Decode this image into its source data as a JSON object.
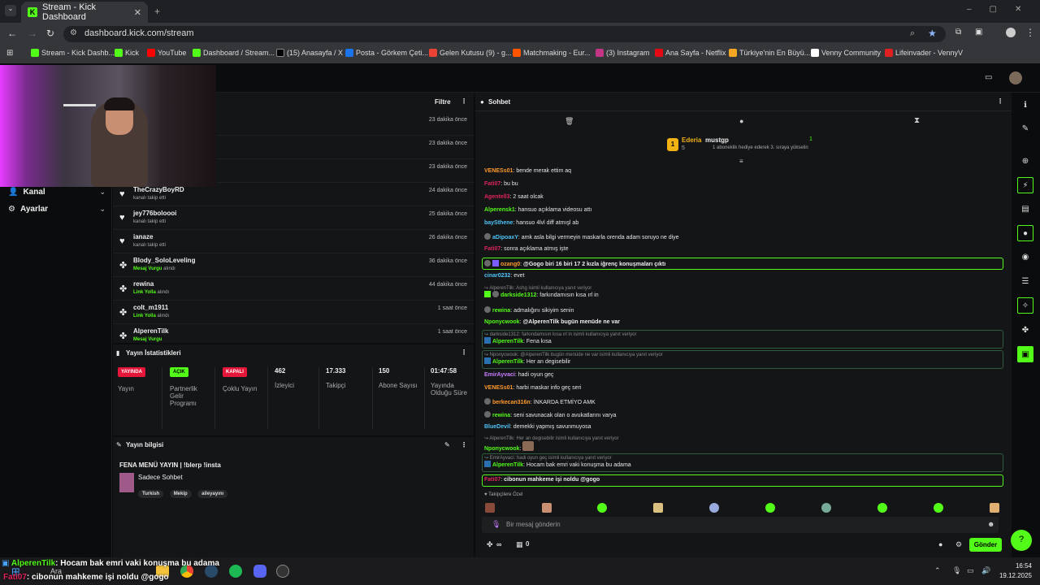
{
  "browser": {
    "tab_title": "Stream - Kick Dashboard",
    "url": "dashboard.kick.com/stream",
    "bookmarks": [
      {
        "label": "Stream - Kick Dashb...",
        "icon": "kick-icon",
        "color": "#53fc18"
      },
      {
        "label": "Kick",
        "icon": "kick-icon",
        "color": "#53fc18"
      },
      {
        "label": "YouTube",
        "icon": "youtube-icon",
        "color": "#ff0000"
      },
      {
        "label": "Dashboard / Stream...",
        "icon": "kick-icon",
        "color": "#53fc18"
      },
      {
        "label": "(15) Anasayfa / X",
        "icon": "x-icon",
        "color": "#000000"
      },
      {
        "label": "Posta - Görkem Çeti...",
        "icon": "mail-icon",
        "color": "#1a73e8"
      },
      {
        "label": "Gelen Kutusu (9) - g...",
        "icon": "gmail-icon",
        "color": "#ea4335"
      },
      {
        "label": "Matchmaking - Eur...",
        "icon": "faceit-icon",
        "color": "#ff5500"
      },
      {
        "label": "(3) Instagram",
        "icon": "instagram-icon",
        "color": "#c13584"
      },
      {
        "label": "Ana Sayfa - Netflix",
        "icon": "netflix-icon",
        "color": "#e50914"
      },
      {
        "label": "Türkiye'nin En Büyü...",
        "icon": "site-icon",
        "color": "#f5a623"
      },
      {
        "label": "Venny Community",
        "icon": "v-icon",
        "color": "#ffffff"
      },
      {
        "label": "Lifeinvader - VennyV",
        "icon": "lifeinvader-icon",
        "color": "#e02020"
      }
    ]
  },
  "leftnav": {
    "items": [
      {
        "label": "Kanal"
      },
      {
        "label": "Ayarlar"
      }
    ]
  },
  "activity": {
    "filter_label": "Filtre",
    "rows": [
      {
        "name": "",
        "sub": "",
        "sub_highlight": "",
        "time": "23 dakika önce"
      },
      {
        "name": "",
        "sub": "",
        "sub_highlight": "",
        "time": "23 dakika önce"
      },
      {
        "name": "",
        "sub": "",
        "sub_highlight": "",
        "time": "23 dakika önce"
      },
      {
        "name": "TheCrazyBoyRD",
        "sub": "kanalı takip etti",
        "sub_highlight": "",
        "time": "24 dakika önce",
        "icon": "heart-icon"
      },
      {
        "name": "jey776boloooi",
        "sub": "kanalı takip etti",
        "sub_highlight": "",
        "time": "25 dakika önce",
        "icon": "heart-icon"
      },
      {
        "name": "ianaze",
        "sub": "kanalı takip etti",
        "sub_highlight": "",
        "time": "26 dakika önce",
        "icon": "heart-icon"
      },
      {
        "name": "Blody_SoloLeveling",
        "sub": "alındı",
        "sub_highlight": "Mesaj Vurgu",
        "time": "36 dakika önce",
        "icon": "reward-icon"
      },
      {
        "name": "rewina",
        "sub": "alındı",
        "sub_highlight": "Link Yolla",
        "time": "44 dakika önce",
        "icon": "reward-icon"
      },
      {
        "name": "colt_m1911",
        "sub": "alındı",
        "sub_highlight": "Link Yolla",
        "time": "1 saat önce",
        "icon": "reward-icon"
      },
      {
        "name": "AlperenTilk",
        "sub": "",
        "sub_highlight": "Mesaj Vurgu",
        "time": "1 saat önce",
        "icon": "reward-icon"
      }
    ]
  },
  "stats": {
    "title": "Yayın İstatistikleri",
    "items": [
      {
        "badge": "YAYINDA",
        "badge_color": "#e4163a",
        "label": "Yayın"
      },
      {
        "badge": "AÇIK",
        "badge_color": "#53fc18",
        "label": "Partnerlik Gelir Programı"
      },
      {
        "badge": "KAPALI",
        "badge_color": "#e4163a",
        "label": "Çoklu Yayın"
      },
      {
        "value": "462",
        "label": "İzleyici"
      },
      {
        "value": "17.333",
        "label": "Takipçi"
      },
      {
        "value": "150",
        "label": "Abone Sayısı"
      },
      {
        "value": "01:47:58",
        "label": "Yayında Olduğu Süre"
      }
    ]
  },
  "info": {
    "title": "Yayın bilgisi",
    "stream_title": "FENA MENÜ YAYIN | !blerp !insta",
    "category": "Sadece Sohbet",
    "tags": [
      "Turkish",
      "Mekip",
      "aileyayını"
    ]
  },
  "chat": {
    "title": "Sohbet",
    "top_gifter": "Ederia",
    "top_gifter_count": "5",
    "gift_user": "mustgp",
    "gift_count": "1",
    "gift_text": "1 aboneklik hediye ederek 3. sıraya yükselin",
    "messages": [
      {
        "user": "VENESs01",
        "color": "#ff9a2e",
        "text": "bende merak ettim aq"
      },
      {
        "user": "Fati07",
        "color": "#e0245e",
        "text": "bu bu"
      },
      {
        "user": "Agentell3",
        "color": "#e0245e",
        "text": "2 saat olcak"
      },
      {
        "user": "Alperensk1",
        "color": "#53fc18",
        "text": "hansuo açıklama videosu attı"
      },
      {
        "user": "baySthene",
        "color": "#4fc3f7",
        "text": "hansuo 4lvl diff atmışl ab"
      },
      {
        "user": "aDipoaxY",
        "color": "#4fc3f7",
        "text": "amk asla bilgi vermeyin maskarla orenda adam soruyo ne diye"
      },
      {
        "user": "Fati07",
        "color": "#e0245e",
        "text": "sonra açıklama atmış işte"
      },
      {
        "user": "ozang0",
        "color": "#ff9a2e",
        "text": "@Gogo biri 16 biri 17 2 kızla iğrenç konuşmaları çıktı"
      },
      {
        "user": "cinar0232",
        "color": "#4fc3f7",
        "text": "evet"
      },
      {
        "reply": "AlperenTilk: Ashg isimli kullanıcıya yanıt veriyor",
        "user": "darkside1312",
        "color": "#53fc18",
        "text": "farkındamısın kısa ırl in"
      },
      {
        "user": "rewina",
        "color": "#53fc18",
        "text": "admalığını sikiyim senin"
      },
      {
        "user": "Nponycwook",
        "color": "#53fc18",
        "text": "@AlperenTilk bugün menüde ne var"
      },
      {
        "reply": "darkside1312: farkındamısın kısa ırl in isimli kullanıcıya yanıt veriyor",
        "user": "AlperenTilk",
        "color": "#53fc18",
        "text": "Fena kısa"
      },
      {
        "reply": "Nponycwook: @AlperenTilk bugün menüde ne var isimli kullanıcıya yanıt veriyor",
        "user": "AlperenTilk",
        "color": "#53fc18",
        "text": "Her an degisebilir"
      },
      {
        "user": "EmirAyvaci",
        "color": "#c77dff",
        "text": "hadi oyun geç"
      },
      {
        "user": "VENESs01",
        "color": "#ff9a2e",
        "text": "harbi maskar info geç seri"
      },
      {
        "user": "berkecan316n",
        "color": "#ff9a2e",
        "text": "İNKARDA ETMİYO AMK"
      },
      {
        "user": "rewina",
        "color": "#53fc18",
        "text": "seni savunacak olan o avukatlarını varya"
      },
      {
        "user": "BlueDevil",
        "color": "#4fc3f7",
        "text": "demekki yapmış savunmuyosa"
      },
      {
        "reply": "AlperenTilk: Her an degisebilir isimli kullanıcıya yanıt veriyor",
        "user": "Nponycwook",
        "color": "#53fc18",
        "text": ""
      },
      {
        "reply": "EmirAyvaci: hadi oyun geç isimli kullanıcıya yanıt veriyor",
        "user": "AlperenTilk",
        "color": "#53fc18",
        "text": "Hocam bak emri vaki konuşma bu adama"
      },
      {
        "user": "Fati07",
        "color": "#e0245e",
        "text": "cibonun mahkeme işi noldu @gogo"
      }
    ],
    "special_label": "Takipçilere Özel",
    "input_placeholder": "Bir mesaj gönderin",
    "points": "∞",
    "counter": "0",
    "send_label": "Gönder"
  },
  "overlay": {
    "line1_user": "AlperenTilk",
    "line1_text": ": Hocam bak emri vaki konuşma bu adama",
    "line2_user": "Fati07",
    "line2_text": ": cibonun mahkeme işi noldu @gogo"
  },
  "taskbar": {
    "search": "Ara",
    "time": "16:54",
    "date": "19.12.2025"
  }
}
